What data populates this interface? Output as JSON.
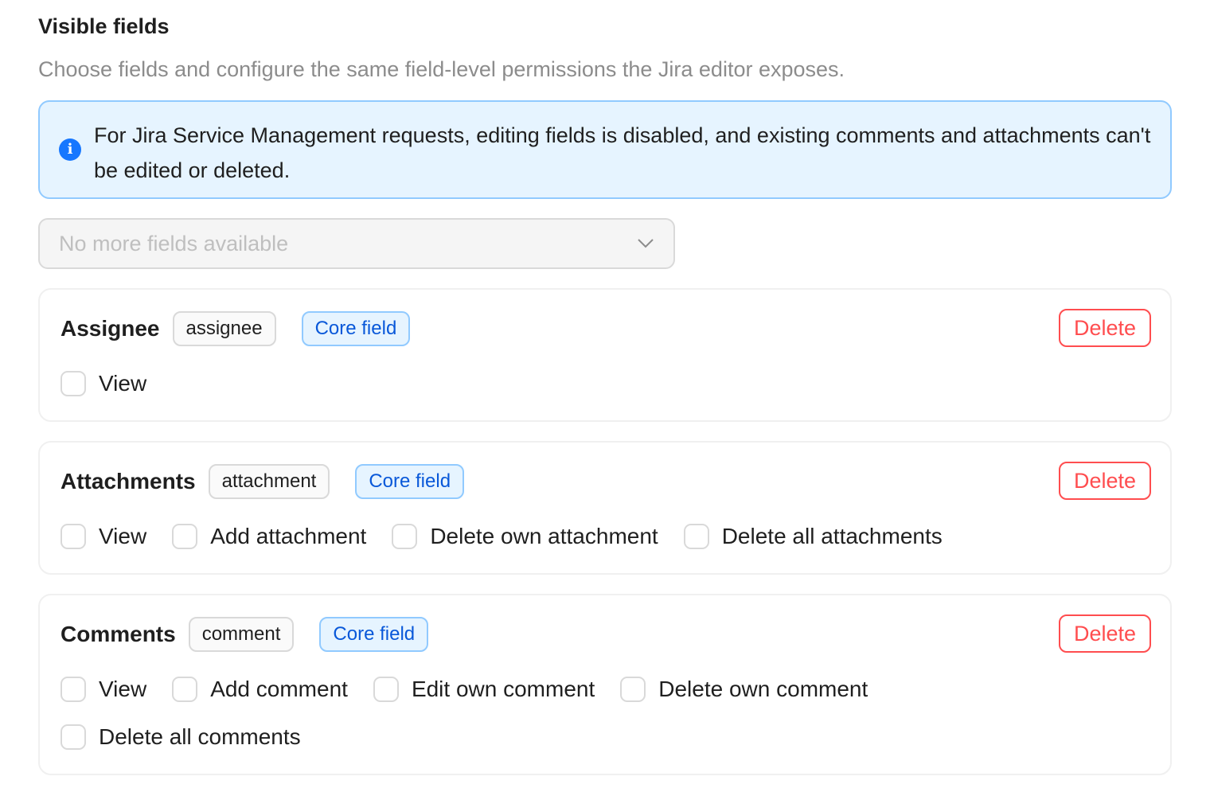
{
  "section": {
    "title": "Visible fields",
    "description": "Choose fields and configure the same field-level permissions the Jira editor exposes."
  },
  "info": {
    "icon": "info-icon",
    "icon_glyph": "i",
    "message": "For Jira Service Management requests, editing fields is disabled, and existing comments and attachments can't be edited or deleted."
  },
  "field_select": {
    "placeholder": "No more fields available",
    "disabled": true
  },
  "fields": [
    {
      "name": "Assignee",
      "key": "assignee",
      "tag": "Core field",
      "delete_label": "Delete",
      "permissions": [
        {
          "label": "View",
          "checked": false
        }
      ]
    },
    {
      "name": "Attachments",
      "key": "attachment",
      "tag": "Core field",
      "delete_label": "Delete",
      "permissions": [
        {
          "label": "View",
          "checked": false
        },
        {
          "label": "Add attachment",
          "checked": false
        },
        {
          "label": "Delete own attachment",
          "checked": false
        },
        {
          "label": "Delete all attachments",
          "checked": false
        }
      ]
    },
    {
      "name": "Comments",
      "key": "comment",
      "tag": "Core field",
      "delete_label": "Delete",
      "permissions": [
        {
          "label": "View",
          "checked": false
        },
        {
          "label": "Add comment",
          "checked": false
        },
        {
          "label": "Edit own comment",
          "checked": false
        },
        {
          "label": "Delete own comment",
          "checked": false
        },
        {
          "label": "Delete all comments",
          "checked": false
        }
      ]
    }
  ],
  "colors": {
    "info_bg": "#e6f4ff",
    "info_border": "#91caff",
    "info_icon": "#1677ff",
    "core_tag_text": "#0958d9",
    "danger": "#ff4d4f"
  }
}
